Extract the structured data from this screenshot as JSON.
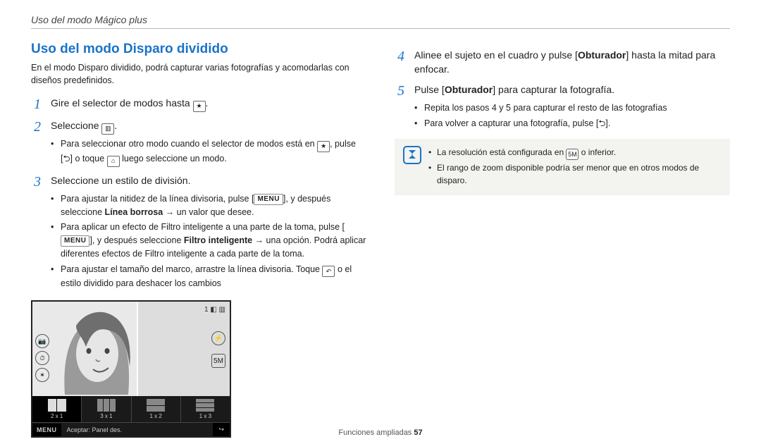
{
  "header": "Uso del modo Mágico plus",
  "title": "Uso del modo Disparo dividido",
  "lead": "En el modo Disparo dividido, podrá capturar varias fotografías y acomodarlas con diseños predefinidos.",
  "steps": {
    "s1": {
      "num": "1",
      "text_a": "Gire el selector de modos hasta ",
      "text_b": "."
    },
    "s2": {
      "num": "2",
      "text_a": "Seleccione ",
      "text_b": ".",
      "b1_a": "Para seleccionar otro modo cuando el selector de modos está en ",
      "b1_b": ", pulse [",
      "b1_c": "] o toque ",
      "b1_d": " luego seleccione un modo."
    },
    "s3": {
      "num": "3",
      "text": "Seleccione un estilo de división.",
      "b1_a": "Para ajustar la nitidez de la línea divisoria, pulse [",
      "b1_b": "], y después seleccione ",
      "b1_bold": "Línea borrosa",
      "b1_c": " → un valor que desee.",
      "b2_a": "Para aplicar un efecto de Filtro inteligente a una parte de la toma, pulse [",
      "b2_b": "], y después seleccione ",
      "b2_bold": "Filtro inteligente",
      "b2_c": " → una opción. Podrá aplicar diferentes efectos de Filtro inteligente a cada parte de la toma.",
      "b3_a": "Para ajustar el tamaño del marco, arrastre la línea divisoria. Toque ",
      "b3_b": " o el estilo dividido para deshacer los cambios"
    },
    "s4": {
      "num": "4",
      "text_a": "Alinee el sujeto en el cuadro y pulse [",
      "bold": "Obturador",
      "text_b": "] hasta la mitad para enfocar."
    },
    "s5": {
      "num": "5",
      "text_a": "Pulse [",
      "bold": "Obturador",
      "text_b": "] para capturar la fotografía.",
      "b1": "Repita los pasos 4 y 5 para capturar el resto de las fotografías",
      "b2_a": "Para volver a capturar una fotografía, pulse [",
      "b2_b": "]."
    }
  },
  "note": {
    "l1_a": "La resolución está configurada en ",
    "l1_b": " o inferior.",
    "l2": "El rango de zoom disponible podría ser menor que en otros modos de disparo."
  },
  "screenshot": {
    "thumbs": [
      "2 x 1",
      "3 x 1",
      "1 x 2",
      "1 x 3"
    ],
    "bar_menu": "MENU",
    "bar_mid": "Aceptar: Panel des."
  },
  "footer": {
    "label": "Funciones ampliadas  ",
    "page": "57"
  },
  "menu_label": "MENU"
}
